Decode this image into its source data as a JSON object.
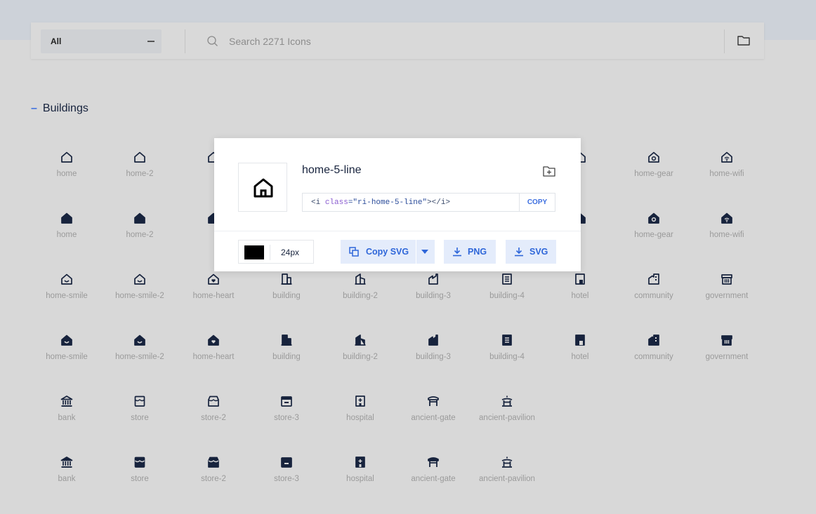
{
  "toolbar": {
    "category_value": "All",
    "search_placeholder": "Search 2271 Icons"
  },
  "section": {
    "title": "Buildings"
  },
  "colors": {
    "accent": "#3d6fe0",
    "icon": "#17233d",
    "label": "#9a9a9a"
  },
  "grid": {
    "rows": [
      {
        "style": "line",
        "items": [
          {
            "icon": "home",
            "label": "home"
          },
          {
            "icon": "home",
            "label": "home-2"
          },
          {
            "icon": "home",
            "label": ""
          },
          {
            "icon": "none",
            "label": ""
          },
          {
            "icon": "none",
            "label": ""
          },
          {
            "icon": "none",
            "label": ""
          },
          {
            "icon": "none",
            "label": ""
          },
          {
            "icon": "home",
            "label": ""
          },
          {
            "icon": "home-gear",
            "label": "home-gear"
          },
          {
            "icon": "home-wifi",
            "label": "home-wifi"
          }
        ]
      },
      {
        "style": "fill",
        "items": [
          {
            "icon": "home",
            "label": "home"
          },
          {
            "icon": "home",
            "label": "home-2"
          },
          {
            "icon": "home",
            "label": ""
          },
          {
            "icon": "none",
            "label": ""
          },
          {
            "icon": "none",
            "label": ""
          },
          {
            "icon": "none",
            "label": ""
          },
          {
            "icon": "none",
            "label": ""
          },
          {
            "icon": "home",
            "label": ""
          },
          {
            "icon": "home-gear",
            "label": "home-gear"
          },
          {
            "icon": "home-wifi",
            "label": "home-wifi"
          }
        ]
      },
      {
        "style": "line",
        "items": [
          {
            "icon": "home-smile",
            "label": "home-smile"
          },
          {
            "icon": "home-smile",
            "label": "home-smile-2"
          },
          {
            "icon": "home-heart",
            "label": "home-heart"
          },
          {
            "icon": "building",
            "label": "building"
          },
          {
            "icon": "building-2",
            "label": "building-2"
          },
          {
            "icon": "building-3",
            "label": "building-3"
          },
          {
            "icon": "building-4",
            "label": "building-4"
          },
          {
            "icon": "hotel",
            "label": "hotel"
          },
          {
            "icon": "community",
            "label": "community"
          },
          {
            "icon": "government",
            "label": "government"
          }
        ]
      },
      {
        "style": "fill",
        "items": [
          {
            "icon": "home-smile",
            "label": "home-smile"
          },
          {
            "icon": "home-smile",
            "label": "home-smile-2"
          },
          {
            "icon": "home-heart",
            "label": "home-heart"
          },
          {
            "icon": "building",
            "label": "building"
          },
          {
            "icon": "building-2",
            "label": "building-2"
          },
          {
            "icon": "building-3",
            "label": "building-3"
          },
          {
            "icon": "building-4",
            "label": "building-4"
          },
          {
            "icon": "hotel",
            "label": "hotel"
          },
          {
            "icon": "community",
            "label": "community"
          },
          {
            "icon": "government",
            "label": "government"
          }
        ]
      },
      {
        "style": "line",
        "items": [
          {
            "icon": "bank",
            "label": "bank"
          },
          {
            "icon": "store",
            "label": "store"
          },
          {
            "icon": "store-2",
            "label": "store-2"
          },
          {
            "icon": "store-3",
            "label": "store-3"
          },
          {
            "icon": "hospital",
            "label": "hospital"
          },
          {
            "icon": "ancient-gate",
            "label": "ancient-gate"
          },
          {
            "icon": "ancient-pavilion",
            "label": "ancient-pavilion"
          }
        ]
      },
      {
        "style": "fill",
        "items": [
          {
            "icon": "bank",
            "label": "bank"
          },
          {
            "icon": "store",
            "label": "store"
          },
          {
            "icon": "store-2",
            "label": "store-2"
          },
          {
            "icon": "store-3",
            "label": "store-3"
          },
          {
            "icon": "hospital",
            "label": "hospital"
          },
          {
            "icon": "ancient-gate",
            "label": "ancient-gate"
          },
          {
            "icon": "ancient-pavilion",
            "label": "ancient-pavilion"
          }
        ]
      }
    ]
  },
  "popup": {
    "icon_name": "home-5-line",
    "code_prefix": "<i ",
    "code_attr": "class",
    "code_value": "=\"ri-home-5-line\"",
    "code_suffix": "></i>",
    "copy_code_label": "COPY",
    "color": "#000000",
    "size": "24px",
    "copy_svg_label": "Copy SVG",
    "png_label": "PNG",
    "svg_label": "SVG"
  }
}
